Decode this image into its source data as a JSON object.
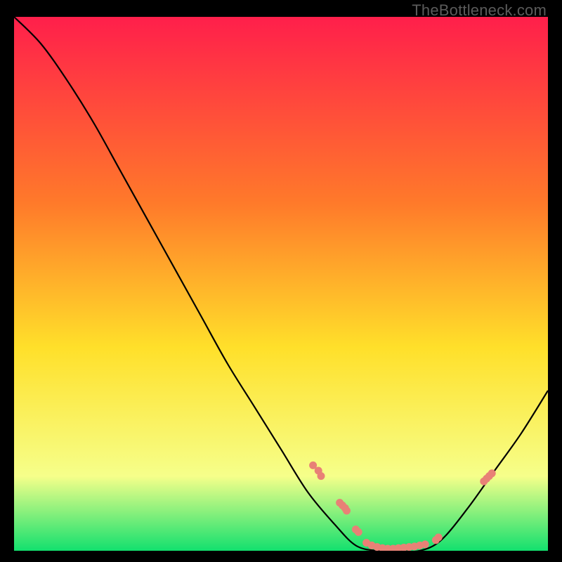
{
  "watermark": "TheBottleneck.com",
  "chart_data": {
    "type": "line",
    "title": "",
    "xlabel": "",
    "ylabel": "",
    "xlim": [
      0,
      100
    ],
    "ylim": [
      0,
      100
    ],
    "bg_gradient": {
      "top": "#ff1f4b",
      "mid1": "#ff7a2a",
      "mid2": "#ffe02a",
      "mid3": "#f6ff8a",
      "bottom": "#13e06e"
    },
    "curve": [
      {
        "x": 0,
        "y": 100
      },
      {
        "x": 5,
        "y": 95
      },
      {
        "x": 10,
        "y": 88
      },
      {
        "x": 15,
        "y": 80
      },
      {
        "x": 20,
        "y": 71
      },
      {
        "x": 25,
        "y": 62
      },
      {
        "x": 30,
        "y": 53
      },
      {
        "x": 35,
        "y": 44
      },
      {
        "x": 40,
        "y": 35
      },
      {
        "x": 45,
        "y": 27
      },
      {
        "x": 50,
        "y": 19
      },
      {
        "x": 55,
        "y": 11
      },
      {
        "x": 60,
        "y": 5
      },
      {
        "x": 64,
        "y": 1
      },
      {
        "x": 68,
        "y": 0
      },
      {
        "x": 72,
        "y": 0
      },
      {
        "x": 76,
        "y": 0
      },
      {
        "x": 80,
        "y": 2
      },
      {
        "x": 85,
        "y": 8
      },
      {
        "x": 90,
        "y": 15
      },
      {
        "x": 95,
        "y": 22
      },
      {
        "x": 100,
        "y": 30
      }
    ],
    "markers": [
      {
        "x": 56,
        "y": 16
      },
      {
        "x": 57,
        "y": 15
      },
      {
        "x": 57.5,
        "y": 14
      },
      {
        "x": 61,
        "y": 9
      },
      {
        "x": 61.5,
        "y": 8.5
      },
      {
        "x": 62,
        "y": 8
      },
      {
        "x": 62.3,
        "y": 7.5
      },
      {
        "x": 64,
        "y": 4
      },
      {
        "x": 64.5,
        "y": 3.5
      },
      {
        "x": 66,
        "y": 1.5
      },
      {
        "x": 67,
        "y": 1
      },
      {
        "x": 68,
        "y": 0.7
      },
      {
        "x": 69,
        "y": 0.5
      },
      {
        "x": 70,
        "y": 0.4
      },
      {
        "x": 71,
        "y": 0.4
      },
      {
        "x": 72,
        "y": 0.5
      },
      {
        "x": 73,
        "y": 0.6
      },
      {
        "x": 74,
        "y": 0.7
      },
      {
        "x": 75,
        "y": 0.8
      },
      {
        "x": 76,
        "y": 1
      },
      {
        "x": 77,
        "y": 1.2
      },
      {
        "x": 79,
        "y": 2
      },
      {
        "x": 79.5,
        "y": 2.5
      },
      {
        "x": 88,
        "y": 13
      },
      {
        "x": 88.5,
        "y": 13.5
      },
      {
        "x": 89,
        "y": 14
      },
      {
        "x": 89.5,
        "y": 14.5
      }
    ],
    "marker_color": "#e88176",
    "curve_color": "#000000"
  }
}
